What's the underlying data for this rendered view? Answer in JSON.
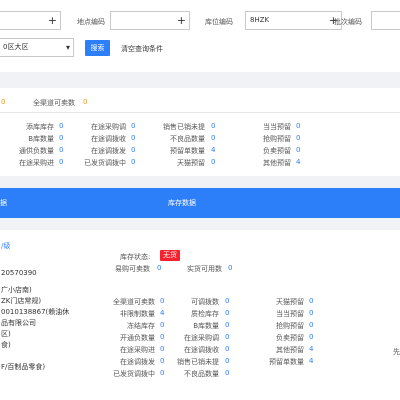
{
  "filters": {
    "site_code_label": "地点编码",
    "warehouse_code_label": "库位编码",
    "warehouse_code_value": "8HZK",
    "batch_code_label": "批次编码",
    "region_value": "0区大区",
    "search_label": "搜索",
    "clear_label": "清空查询条件",
    "plus_glyph": "+",
    "chevron_glyph": "▾"
  },
  "summary": {
    "first_value": "0",
    "all_channel_label": "全渠道可卖数",
    "all_channel_value": "0"
  },
  "stats": [
    {
      "label": "添库库存",
      "value": "0"
    },
    {
      "label": "在途采购调",
      "value": "0"
    },
    {
      "label": "销售已销未提",
      "value": "0"
    },
    {
      "label": "当当预留",
      "value": "0"
    },
    {
      "label": "B库数量",
      "value": "0"
    },
    {
      "label": "在途调拨收",
      "value": "0"
    },
    {
      "label": "不良品数量",
      "value": "0"
    },
    {
      "label": "抢购预留",
      "value": "0"
    },
    {
      "label": "通供负数量",
      "value": "0"
    },
    {
      "label": "在途调拨发",
      "value": "0"
    },
    {
      "label": "预留单数量",
      "value": "4"
    },
    {
      "label": "负卖预留",
      "value": "0"
    },
    {
      "label": "在途采购进",
      "value": "0"
    },
    {
      "label": "已发货调拨中",
      "value": "0"
    },
    {
      "label": "天猫预留",
      "value": "0"
    },
    {
      "label": "其他预留",
      "value": "4"
    }
  ],
  "tabs": {
    "left": "据",
    "center": "库存数据"
  },
  "detail": {
    "link_text": "/级",
    "code_text": "20570390",
    "status_label": "库存状态:",
    "status_badge": "无货",
    "saleable_label": "易购可卖数",
    "saleable_value": "0",
    "actual_label": "实货可用数",
    "actual_value": "0",
    "left_lines": [
      "广小店南)",
      "ZK门店常规)",
      "0010138867(赖油休",
      "品有限公司",
      "区)",
      "食)",
      "",
      "F/百制品零食)"
    ],
    "grid": [
      {
        "label": "全渠道可卖数",
        "value": "0"
      },
      {
        "label": "可调拨数",
        "value": "0"
      },
      {
        "label": "天猫预留",
        "value": "0"
      },
      {
        "label": "非限制数量",
        "value": "4"
      },
      {
        "label": "质检库存",
        "value": "0"
      },
      {
        "label": "当当预留",
        "value": "0"
      },
      {
        "label": "冻结库存",
        "value": "0"
      },
      {
        "label": "B库数量",
        "value": "0"
      },
      {
        "label": "抢购预留",
        "value": "0"
      },
      {
        "label": "开通负数量",
        "value": "0"
      },
      {
        "label": "在途采购调",
        "value": "0"
      },
      {
        "label": "负卖预留",
        "value": "0"
      },
      {
        "label": "在途采购进",
        "value": "0"
      },
      {
        "label": "在途调拨收",
        "value": "0"
      },
      {
        "label": "其他预留",
        "value": "4"
      },
      {
        "label": "在途调拨发",
        "value": "0"
      },
      {
        "label": "销售已销未提",
        "value": "0"
      },
      {
        "label": "预留单数量",
        "value": "4"
      },
      {
        "label": "已发货调拨中",
        "value": "0"
      },
      {
        "label": "不良品数量",
        "value": "0"
      }
    ],
    "right_edge_label": "先"
  },
  "colors": {
    "accent": "#2d7ff9",
    "badge": "#f5222d"
  }
}
